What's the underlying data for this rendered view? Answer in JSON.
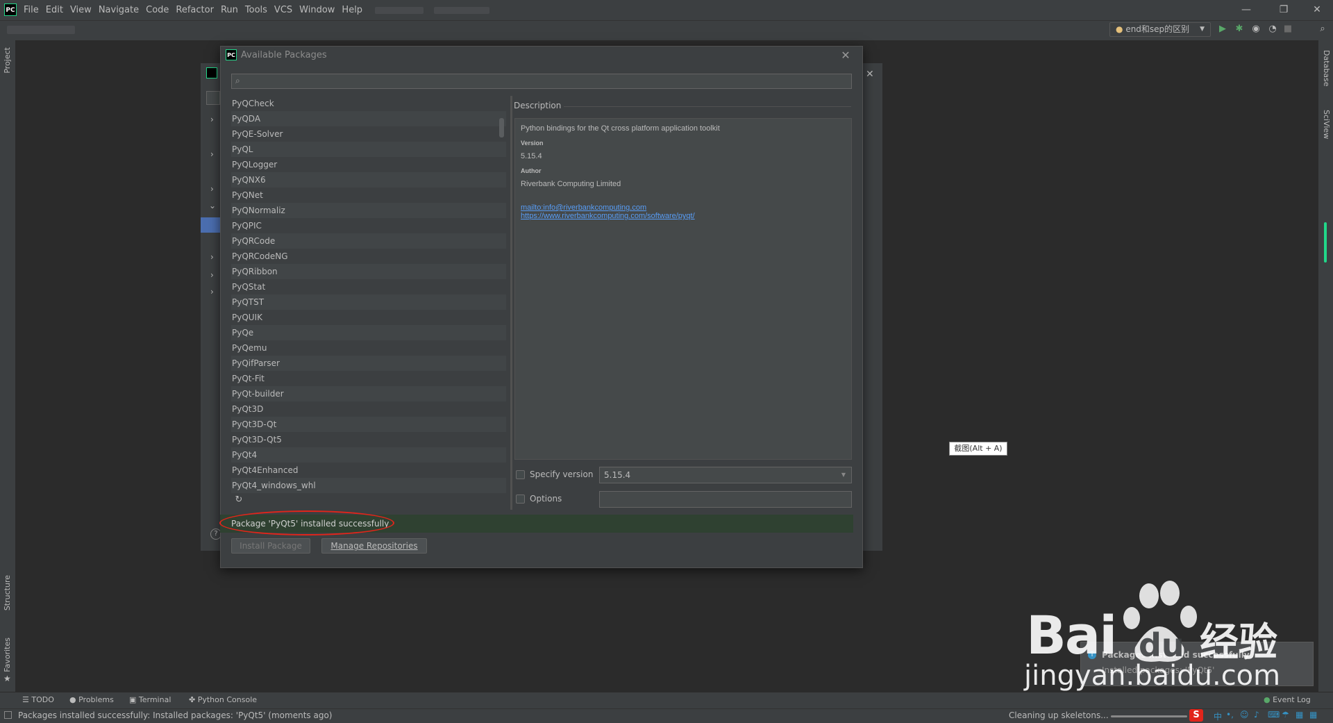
{
  "menu": [
    "File",
    "Edit",
    "View",
    "Navigate",
    "Code",
    "Refactor",
    "Run",
    "Tools",
    "VCS",
    "Window",
    "Help"
  ],
  "run_config": "end和sep的区别",
  "left_tools": {
    "project": "Project",
    "structure": "Structure",
    "favorites": "Favorites"
  },
  "right_tools": {
    "database": "Database",
    "sciview": "SciView"
  },
  "dialog": {
    "title": "Available Packages",
    "search_placeholder": "",
    "packages": [
      "PyQCheck",
      "PyQDA",
      "PyQE-Solver",
      "PyQL",
      "PyQLogger",
      "PyQNX6",
      "PyQNet",
      "PyQNormaliz",
      "PyQPIC",
      "PyQRCode",
      "PyQRCodeNG",
      "PyQRibbon",
      "PyQStat",
      "PyQTST",
      "PyQUIK",
      "PyQe",
      "PyQemu",
      "PyQifParser",
      "PyQt-Fit",
      "PyQt-builder",
      "PyQt3D",
      "PyQt3D-Qt",
      "PyQt3D-Qt5",
      "PyQt4",
      "PyQt4Enhanced",
      "PyQt4_windows_whl"
    ],
    "description_label": "Description",
    "description": {
      "summary": "Python bindings for the Qt cross platform application toolkit",
      "version_label": "Version",
      "version": "5.15.4",
      "author_label": "Author",
      "author": "Riverbank Computing Limited",
      "mailto": "mailto:info@riverbankcomputing.com",
      "url": "https://www.riverbankcomputing.com/software/pyqt/"
    },
    "specify_version_label": "Specify version",
    "specify_version_value": "5.15.4",
    "options_label": "Options",
    "options_value": "",
    "status": "Package 'PyQt5' installed successfully",
    "install_button": "Install Package",
    "manage_button": "Manage Repositories"
  },
  "tooltip": "截图(Alt + A)",
  "notification": {
    "title": "Packages installed successfully",
    "body": "Installed packages: 'PyQt5'"
  },
  "bottom_tabs": [
    "TODO",
    "Problems",
    "Terminal",
    "Python Console"
  ],
  "event_log": "Event Log",
  "status_message": "Packages installed successfully: Installed packages: 'PyQt5' (moments ago)",
  "status_right": "Cleaning up skeletons...",
  "ime": "中",
  "watermark": {
    "brand": "Bai",
    "brand2": "du",
    "cn": "经验",
    "url": "jingyan.baidu.com"
  },
  "colors": {
    "accent": "#589df6",
    "success_bg": "#2f4131",
    "annotation": "#e1251b"
  }
}
